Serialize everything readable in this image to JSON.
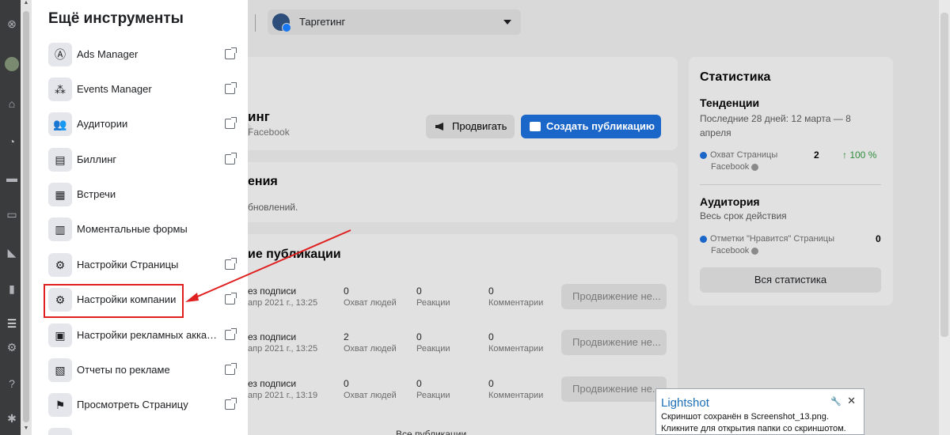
{
  "drawer": {
    "title": "Ещё инструменты",
    "items": [
      {
        "label": "Ads Manager",
        "icon": "ads-manager-icon",
        "glyph": "Ⓐ",
        "external": true
      },
      {
        "label": "Events Manager",
        "icon": "events-manager-icon",
        "glyph": "⁂",
        "external": true
      },
      {
        "label": "Аудитории",
        "icon": "audiences-icon",
        "glyph": "👥",
        "external": true
      },
      {
        "label": "Биллинг",
        "icon": "billing-icon",
        "glyph": "▤",
        "external": true
      },
      {
        "label": "Встречи",
        "icon": "calendar-icon",
        "glyph": "▦",
        "external": false
      },
      {
        "label": "Моментальные формы",
        "icon": "form-icon",
        "glyph": "▥",
        "external": false
      },
      {
        "label": "Настройки Страницы",
        "icon": "gear-icon",
        "glyph": "⚙",
        "external": true
      },
      {
        "label": "Настройки компании",
        "icon": "gear-icon",
        "glyph": "⚙",
        "external": true
      },
      {
        "label": "Настройки рекламных аккаунтов",
        "icon": "ad-accounts-icon",
        "glyph": "▣",
        "external": true
      },
      {
        "label": "Отчеты по рекламе",
        "icon": "reports-icon",
        "glyph": "▧",
        "external": true
      },
      {
        "label": "Просмотреть Страницу",
        "icon": "flag-icon",
        "glyph": "⚑",
        "external": true
      }
    ]
  },
  "topbar": {
    "page_selector": "Таргетинг"
  },
  "main": {
    "card1": {
      "title_fragment": "инг",
      "subtitle_fragment": "Facebook",
      "promote_label": "Продвигать",
      "create_post_label": "Создать публикацию"
    },
    "card2": {
      "title_fragment": "ения",
      "text_fragment": "бновлений."
    },
    "card3": {
      "title_fragment": "ие публикации",
      "rows": [
        {
          "title": "ез подписи",
          "date": "апр 2021 г., 13:25",
          "reach": "0",
          "reach_label": "Охват людей",
          "reactions": "0",
          "reactions_label": "Реакции",
          "comments": "0",
          "comments_label": "Комментарии",
          "button": "Продвижение не..."
        },
        {
          "title": "ез подписи",
          "date": "апр 2021 г., 13:25",
          "reach": "2",
          "reach_label": "Охват людей",
          "reactions": "0",
          "reactions_label": "Реакции",
          "comments": "0",
          "comments_label": "Комментарии",
          "button": "Продвижение не..."
        },
        {
          "title": "ез подписи",
          "date": "апр 2021 г., 13:19",
          "reach": "0",
          "reach_label": "Охват людей",
          "reactions": "0",
          "reactions_label": "Реакции",
          "comments": "0",
          "comments_label": "Комментарии",
          "button": "Продвижение не..."
        }
      ],
      "all_posts": "Все публикации"
    }
  },
  "stats": {
    "title": "Статистика",
    "trends_title": "Тенденции",
    "trends_period": "Последние 28 дней: 12 марта — 8 апреля",
    "reach_label_1": "Охват Страницы",
    "reach_label_2": "Facebook",
    "reach_value": "2",
    "reach_change": "↑ 100 %",
    "audience_title": "Аудитория",
    "audience_period": "Весь срок действия",
    "likes_label_1": "Отметки \"Нравится\" Страницы",
    "likes_label_2": "Facebook",
    "likes_value": "0",
    "all_stats_button": "Вся статистика"
  },
  "toast": {
    "title": "Lightshot",
    "message": "Скриншот сохранён в Screenshot_13.png. Кликните для открытия папки со скриншотом.",
    "pin": "🔧",
    "close": "✕"
  },
  "colors": {
    "accent": "#1b66c9",
    "highlight": "#e02020",
    "positive": "#2e8b3a"
  }
}
